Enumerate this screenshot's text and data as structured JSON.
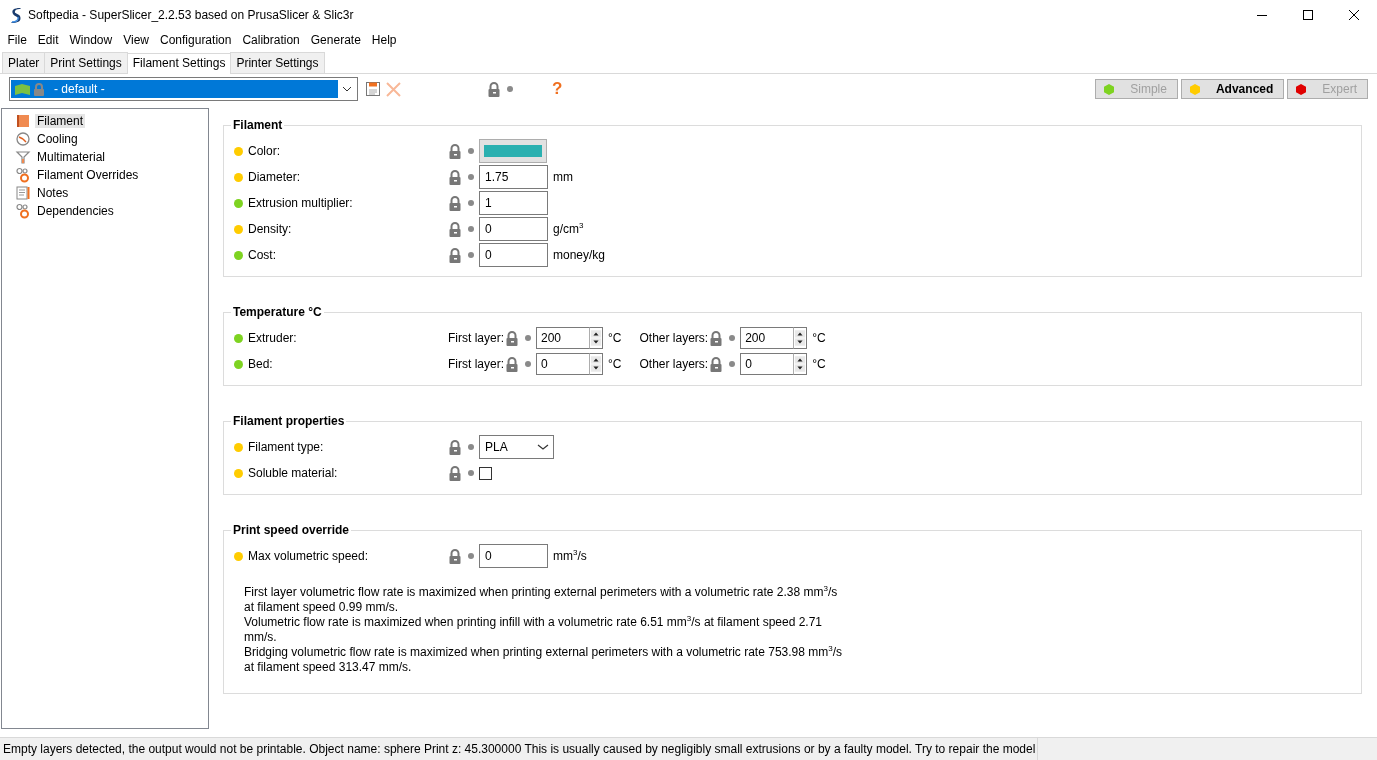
{
  "window": {
    "title": "Softpedia - SuperSlicer_2.2.53 based on PrusaSlicer & Slic3r"
  },
  "menu": [
    "File",
    "Edit",
    "Window",
    "View",
    "Configuration",
    "Calibration",
    "Generate",
    "Help"
  ],
  "tabs": [
    {
      "label": "Plater",
      "selected": false
    },
    {
      "label": "Print Settings",
      "selected": false
    },
    {
      "label": "Filament Settings",
      "selected": true
    },
    {
      "label": "Printer Settings",
      "selected": false
    }
  ],
  "preset": {
    "value": "- default -"
  },
  "help_button": "?",
  "modes": [
    {
      "label": "Simple",
      "color": "#7ed321",
      "selected": false
    },
    {
      "label": "Advanced",
      "color": "#ffcc00",
      "selected": true
    },
    {
      "label": "Expert",
      "color": "#e00000",
      "selected": false
    }
  ],
  "sidebar": {
    "items": [
      {
        "label": "Filament",
        "selected": true
      },
      {
        "label": "Cooling",
        "selected": false
      },
      {
        "label": "Multimaterial",
        "selected": false
      },
      {
        "label": "Filament Overrides",
        "selected": false
      },
      {
        "label": "Notes",
        "selected": false
      },
      {
        "label": "Dependencies",
        "selected": false
      }
    ]
  },
  "groups": [
    {
      "title": "Filament",
      "options": [
        {
          "kind": "color",
          "label": "Color:",
          "color": "#ffcc00"
        },
        {
          "kind": "text",
          "label": "Diameter:",
          "color": "#ffcc00",
          "value": "1.75",
          "unit": "mm"
        },
        {
          "kind": "text",
          "label": "Extrusion multiplier:",
          "color": "#7ed321",
          "value": "1"
        },
        {
          "kind": "text",
          "label": "Density:",
          "color": "#ffcc00",
          "value": "0",
          "unit": "g/cm$^{3}$"
        },
        {
          "kind": "text",
          "label": "Cost:",
          "color": "#7ed321",
          "value": "0",
          "unit": "money/kg"
        }
      ]
    },
    {
      "title": "Temperature °C",
      "options": [
        {
          "kind": "spins",
          "label": "Extruder:",
          "color": "#7ed321",
          "fields": [
            {
              "label": "First layer:",
              "value": "200",
              "unit": "°C"
            },
            {
              "label": "Other layers:",
              "value": "200",
              "unit": "°C"
            }
          ]
        },
        {
          "kind": "spins",
          "label": "Bed:",
          "color": "#7ed321",
          "fields": [
            {
              "label": "First layer:",
              "value": "0",
              "unit": "°C"
            },
            {
              "label": "Other layers:",
              "value": "0",
              "unit": "°C"
            }
          ]
        }
      ]
    },
    {
      "title": "Filament properties",
      "options": [
        {
          "kind": "combo",
          "label": "Filament type:",
          "color": "#ffcc00",
          "value": "PLA"
        },
        {
          "kind": "checkbox",
          "label": "Soluble material:",
          "color": "#ffcc00",
          "checked": false
        }
      ]
    },
    {
      "title": "Print speed override",
      "options": [
        {
          "kind": "text",
          "label": "Max volumetric speed:",
          "color": "#ffcc00",
          "value": "0",
          "unit": "mm$^{3}$/s"
        }
      ],
      "help": [
        "First layer volumetric flow rate is maximized when printing external perimeters with a volumetric rate 2.38 mm$^{3}$/s at filament speed 0.99 mm/s.",
        "Volumetric flow rate is maximized when printing infill with a volumetric rate 6.51 mm$^{3}$/s at filament speed 2.71 mm/s.",
        "Bridging volumetric flow rate is maximized when printing external perimeters with a volumetric rate 753.98 mm$^{3}$/s at filament speed 313.47 mm/s."
      ]
    }
  ],
  "status_bar": "Empty layers detected, the output would not be printable.  Object name: sphere Print z: 45.300000  This is usually caused by negligibly small extrusions or by a faulty model. Try to repair the model"
}
